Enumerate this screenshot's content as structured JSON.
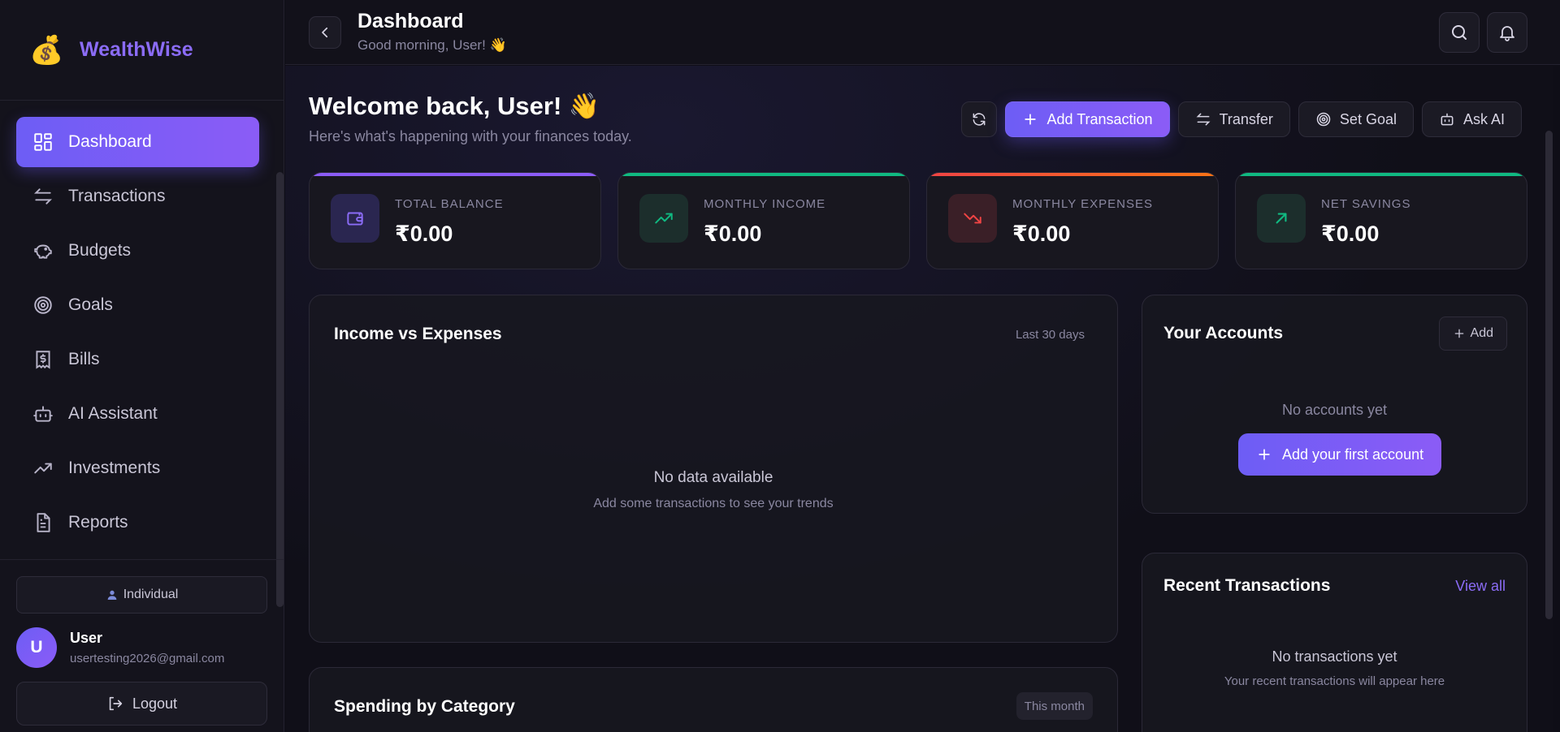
{
  "brand": {
    "name": "WealthWise",
    "logo_emoji": "💰"
  },
  "sidebar": {
    "items": [
      {
        "label": "Dashboard",
        "icon": "dashboard-icon",
        "active": true
      },
      {
        "label": "Transactions",
        "icon": "arrows-icon"
      },
      {
        "label": "Budgets",
        "icon": "piggy-bank-icon"
      },
      {
        "label": "Goals",
        "icon": "target-icon"
      },
      {
        "label": "Bills",
        "icon": "receipt-icon"
      },
      {
        "label": "AI Assistant",
        "icon": "bot-icon"
      },
      {
        "label": "Investments",
        "icon": "trending-up-icon"
      },
      {
        "label": "Reports",
        "icon": "file-icon"
      }
    ],
    "mode_label": "Individual",
    "user": {
      "initial": "U",
      "name": "User",
      "email": "usertesting2026@gmail.com"
    },
    "logout_label": "Logout"
  },
  "header": {
    "title": "Dashboard",
    "subtitle": "Good morning, User! 👋"
  },
  "welcome": {
    "title": "Welcome back, User! 👋",
    "subtitle": "Here's what's happening with your finances today."
  },
  "actions": {
    "add_transaction": "Add Transaction",
    "transfer": "Transfer",
    "set_goal": "Set Goal",
    "ask_ai": "Ask AI"
  },
  "stats": [
    {
      "label": "TOTAL BALANCE",
      "value": "₹0.00",
      "bar_color": "#8b5cf6",
      "icon": "wallet-icon",
      "icon_color": "#8b6cf6",
      "icon_bg": "#2a2650"
    },
    {
      "label": "MONTHLY INCOME",
      "value": "₹0.00",
      "bar_color": "#10b981",
      "icon": "trending-up-icon",
      "icon_color": "#10b981",
      "icon_bg": "#1c2e2c"
    },
    {
      "label": "MONTHLY EXPENSES",
      "value": "₹0.00",
      "bar_color": "#ef4444",
      "icon": "trending-down-icon",
      "icon_color": "#ef4444",
      "icon_bg": "#3a1f27"
    },
    {
      "label": "NET SAVINGS",
      "value": "₹0.00",
      "bar_color": "#10b981",
      "icon": "arrow-up-right-icon",
      "icon_color": "#10b981",
      "icon_bg": "#1c2e2c"
    }
  ],
  "income_chart": {
    "title": "Income vs Expenses",
    "range": "Last 30 days",
    "empty_title": "No data available",
    "empty_sub": "Add some transactions to see your trends"
  },
  "accounts": {
    "title": "Your Accounts",
    "add_label": "Add",
    "empty_title": "No accounts yet",
    "cta_label": "Add your first account"
  },
  "recent": {
    "title": "Recent Transactions",
    "view_all": "View all",
    "empty_title": "No transactions yet",
    "empty_sub": "Your recent transactions will appear here"
  },
  "spending": {
    "title": "Spending by Category",
    "range": "This month"
  }
}
